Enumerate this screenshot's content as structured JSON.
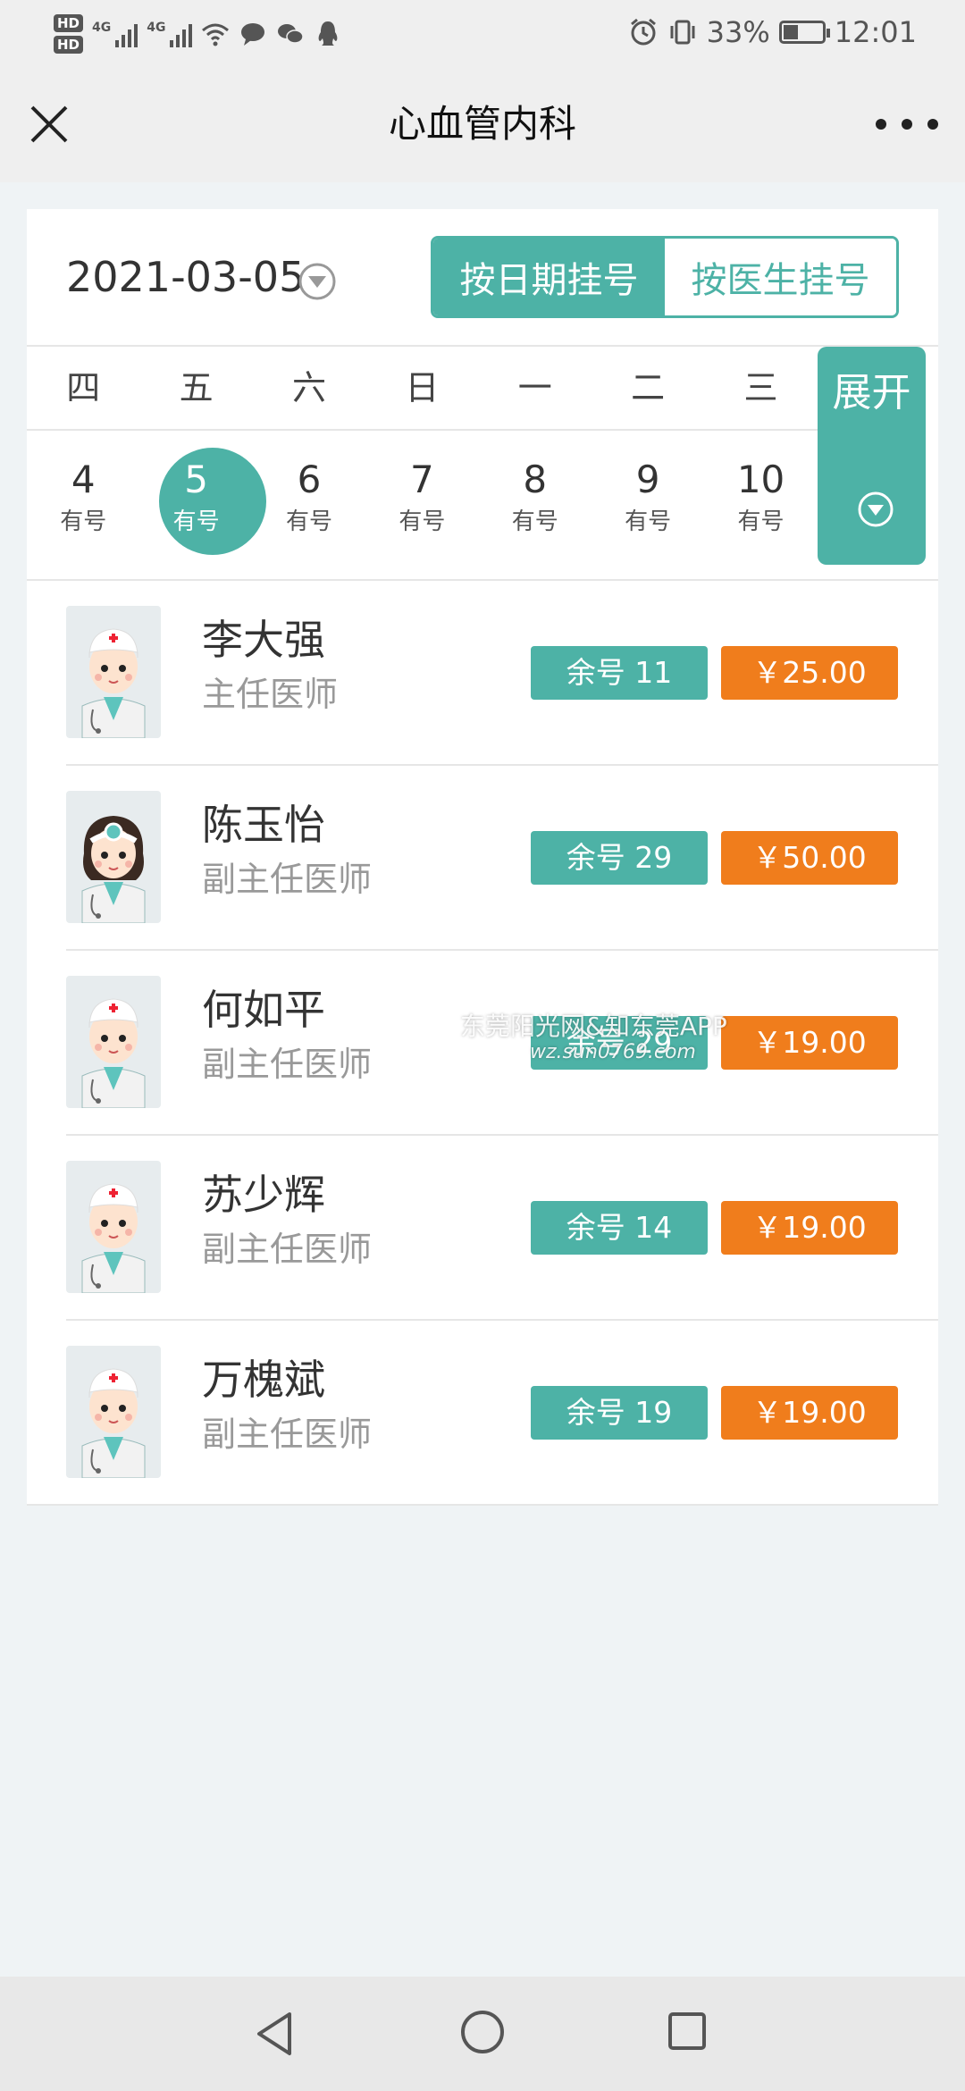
{
  "status_bar": {
    "battery_percent": "33%",
    "time": "12:01",
    "network_type": "4G",
    "hd_labels": [
      "HD",
      "HD"
    ]
  },
  "title_bar": {
    "title": "心血管内科"
  },
  "date_selector": {
    "date": "2021-03-05"
  },
  "mode_toggle": {
    "by_date": "按日期挂号",
    "by_doctor": "按医生挂号"
  },
  "week": {
    "weekdays": [
      "四",
      "五",
      "六",
      "日",
      "一",
      "二",
      "三"
    ],
    "days": [
      {
        "num": "4",
        "label": "有号"
      },
      {
        "num": "5",
        "label": "有号"
      },
      {
        "num": "6",
        "label": "有号"
      },
      {
        "num": "7",
        "label": "有号"
      },
      {
        "num": "8",
        "label": "有号"
      },
      {
        "num": "9",
        "label": "有号"
      },
      {
        "num": "10",
        "label": "有号"
      }
    ],
    "expand_label": "展开"
  },
  "doctors": [
    {
      "name": "李大强",
      "title": "主任医师",
      "remaining": "余号 11",
      "price": "￥25.00"
    },
    {
      "name": "陈玉怡",
      "title": "副主任医师",
      "remaining": "余号 29",
      "price": "￥50.00"
    },
    {
      "name": "何如平",
      "title": "副主任医师",
      "remaining": "余号 29",
      "price": "￥19.00"
    },
    {
      "name": "苏少辉",
      "title": "副主任医师",
      "remaining": "余号 14",
      "price": "￥19.00"
    },
    {
      "name": "万槐斌",
      "title": "副主任医师",
      "remaining": "余号 19",
      "price": "￥19.00"
    }
  ],
  "watermark": {
    "line1": "东莞阳光网&知东莞APP",
    "line2": "wz.sun0769.com"
  },
  "colors": {
    "accent": "#4db2a6",
    "price": "#f07d1c"
  }
}
